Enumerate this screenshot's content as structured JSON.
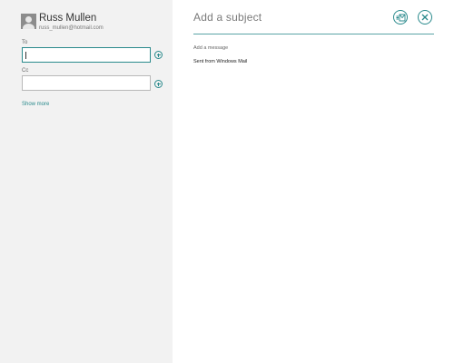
{
  "account": {
    "name": "Russ Mullen",
    "email": "russ_mullen@hotmail.com"
  },
  "recipients": {
    "to_label": "To",
    "to_value": "",
    "cc_label": "Cc",
    "cc_value": "",
    "show_more": "Show more"
  },
  "compose": {
    "subject_placeholder": "Add a subject",
    "message_placeholder": "Add a message",
    "signature": "Sent from Windows Mail"
  },
  "icons": {
    "send": "send-icon",
    "close": "close-icon",
    "add": "plus-circle-icon",
    "avatar": "person-icon"
  },
  "colors": {
    "accent": "#2a8a8c",
    "left_pane": "#f2f2f2"
  }
}
